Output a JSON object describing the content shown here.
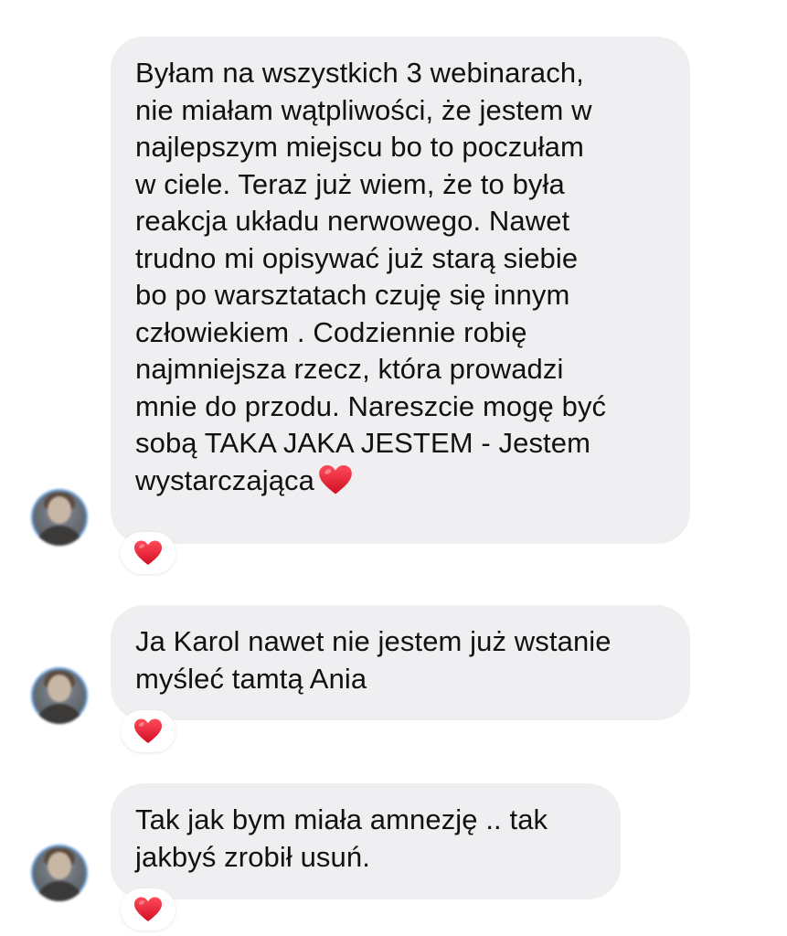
{
  "messages": [
    {
      "text": "Byłam na wszystkich 3 webinarach,\nnie miałam wątpliwości, że jestem w\nnajlepszym miejscu bo to poczułam\nw ciele. Teraz już wiem, że to była\nreakcja układu nerwowego. Nawet\ntrudno mi opisywać już starą siebie\nbo po warsztatach czuję się innym\nczłowiekiem . Codziennie robię\nnajmniejsza rzecz, która prowadzi\nmnie do przodu. Nareszcie mogę być\nsobą TAKA JAKA JESTEM - Jestem\nwystarczająca",
      "trailing_emoji": "red-heart",
      "reaction": "red-heart"
    },
    {
      "text": "Ja Karol nawet nie jestem już wstanie\nmyśleć tamtą Ania",
      "reaction": "red-heart"
    },
    {
      "text": "Tak jak bym miała amnezję .. tak\njakbyś zrobił usuń.",
      "reaction": "red-heart"
    }
  ],
  "colors": {
    "bubble_background": "#efeff1",
    "text": "#111111",
    "heart": "#e8162a"
  },
  "icons": {
    "reaction": "heart-icon",
    "avatar": "user-avatar"
  }
}
